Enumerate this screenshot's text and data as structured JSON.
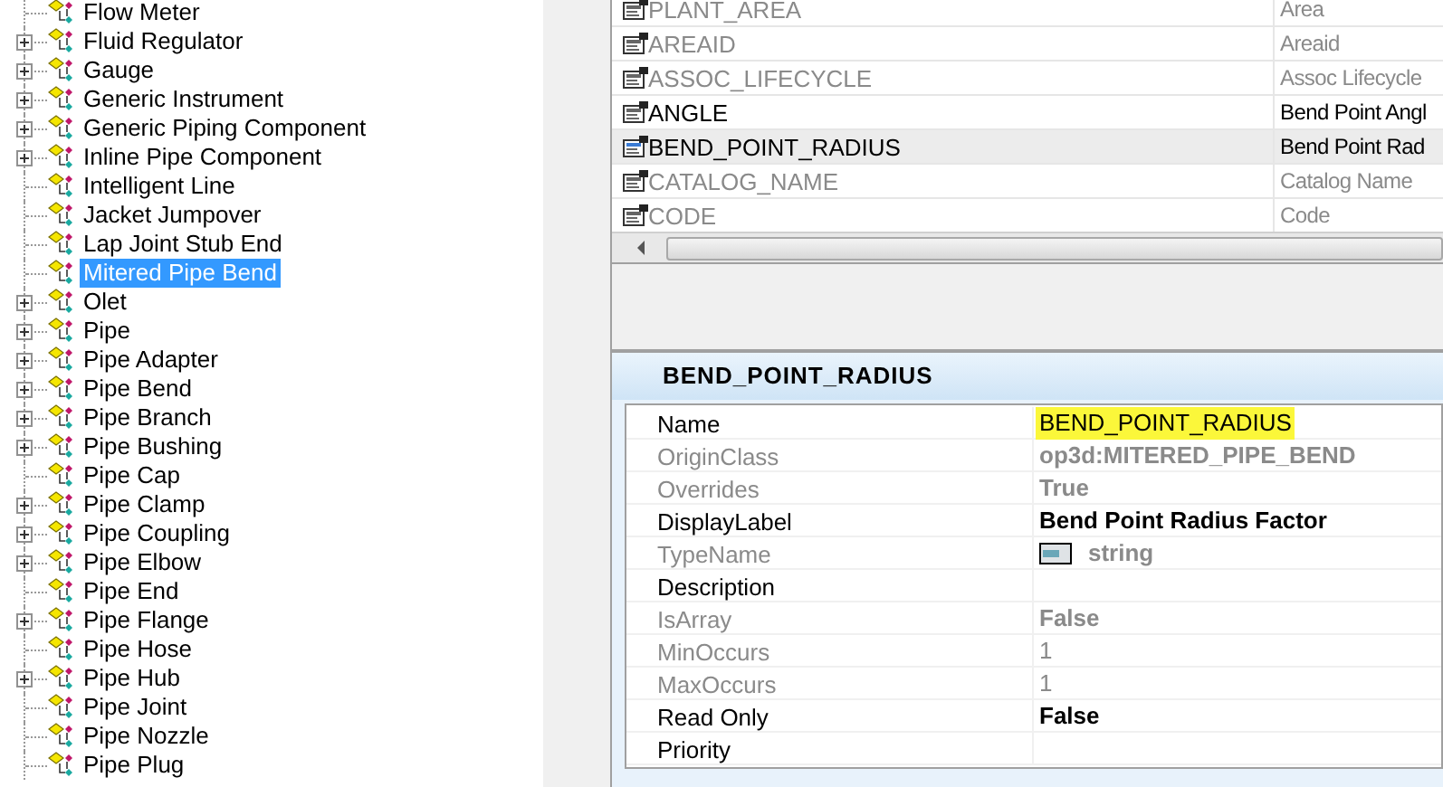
{
  "tree": {
    "items": [
      {
        "label": "Flow Meter",
        "expandable": false,
        "selected": false
      },
      {
        "label": "Fluid Regulator",
        "expandable": true,
        "selected": false
      },
      {
        "label": "Gauge",
        "expandable": true,
        "selected": false
      },
      {
        "label": "Generic Instrument",
        "expandable": true,
        "selected": false
      },
      {
        "label": "Generic Piping Component",
        "expandable": true,
        "selected": false
      },
      {
        "label": "Inline Pipe Component",
        "expandable": true,
        "selected": false
      },
      {
        "label": "Intelligent Line",
        "expandable": false,
        "selected": false
      },
      {
        "label": "Jacket Jumpover",
        "expandable": false,
        "selected": false
      },
      {
        "label": "Lap Joint Stub End",
        "expandable": false,
        "selected": false
      },
      {
        "label": "Mitered Pipe Bend",
        "expandable": false,
        "selected": true
      },
      {
        "label": "Olet",
        "expandable": true,
        "selected": false
      },
      {
        "label": "Pipe",
        "expandable": true,
        "selected": false
      },
      {
        "label": "Pipe Adapter",
        "expandable": true,
        "selected": false
      },
      {
        "label": "Pipe Bend",
        "expandable": true,
        "selected": false
      },
      {
        "label": "Pipe Branch",
        "expandable": true,
        "selected": false
      },
      {
        "label": "Pipe Bushing",
        "expandable": true,
        "selected": false
      },
      {
        "label": "Pipe Cap",
        "expandable": false,
        "selected": false
      },
      {
        "label": "Pipe Clamp",
        "expandable": true,
        "selected": false
      },
      {
        "label": "Pipe Coupling",
        "expandable": true,
        "selected": false
      },
      {
        "label": "Pipe Elbow",
        "expandable": true,
        "selected": false
      },
      {
        "label": "Pipe End",
        "expandable": false,
        "selected": false
      },
      {
        "label": "Pipe Flange",
        "expandable": true,
        "selected": false
      },
      {
        "label": "Pipe Hose",
        "expandable": false,
        "selected": false
      },
      {
        "label": "Pipe Hub",
        "expandable": true,
        "selected": false
      },
      {
        "label": "Pipe Joint",
        "expandable": false,
        "selected": false
      },
      {
        "label": "Pipe Nozzle",
        "expandable": false,
        "selected": false
      },
      {
        "label": "Pipe Plug",
        "expandable": false,
        "selected": false
      }
    ]
  },
  "property_list": {
    "rows": [
      {
        "name": "PLANT_AREA",
        "display_label": "Area",
        "enabled": false,
        "selected": false
      },
      {
        "name": "AREAID",
        "display_label": "Areaid",
        "enabled": false,
        "selected": false
      },
      {
        "name": "ASSOC_LIFECYCLE",
        "display_label": "Assoc Lifecycle",
        "enabled": false,
        "selected": false
      },
      {
        "name": "ANGLE",
        "display_label": "Bend Point Angl",
        "enabled": true,
        "selected": false
      },
      {
        "name": "BEND_POINT_RADIUS",
        "display_label": "Bend Point Rad",
        "enabled": true,
        "selected": true
      },
      {
        "name": "CATALOG_NAME",
        "display_label": "Catalog Name",
        "enabled": false,
        "selected": false
      },
      {
        "name": "CODE",
        "display_label": "Code",
        "enabled": false,
        "selected": false
      }
    ]
  },
  "details": {
    "title": "BEND_POINT_RADIUS",
    "rows": [
      {
        "label": "Name",
        "value": "BEND_POINT_RADIUS",
        "kind": "text",
        "enabled": true,
        "bold": false,
        "highlighted": true
      },
      {
        "label": "OriginClass",
        "value": "op3d:MITERED_PIPE_BEND",
        "kind": "text",
        "enabled": false,
        "bold": true,
        "highlighted": false
      },
      {
        "label": "Overrides",
        "value": "True",
        "kind": "text",
        "enabled": false,
        "bold": true,
        "highlighted": false
      },
      {
        "label": "DisplayLabel",
        "value": "Bend Point Radius Factor",
        "kind": "text",
        "enabled": true,
        "bold": true,
        "highlighted": false
      },
      {
        "label": "TypeName",
        "value": "string",
        "kind": "type",
        "enabled": false,
        "bold": true,
        "highlighted": false
      },
      {
        "label": "Description",
        "enabled": true
      },
      {
        "label": "IsArray",
        "value": "False",
        "kind": "text",
        "enabled": false,
        "bold": true,
        "highlighted": false
      },
      {
        "label": "MinOccurs",
        "value": "1",
        "kind": "text",
        "enabled": false,
        "bold": false,
        "highlighted": false
      },
      {
        "label": "MaxOccurs",
        "value": "1",
        "kind": "text",
        "enabled": false,
        "bold": false,
        "highlighted": false
      },
      {
        "label": "Read Only",
        "value": "False",
        "kind": "text",
        "enabled": true,
        "bold": true,
        "highlighted": false
      },
      {
        "label": "Priority",
        "enabled": true
      }
    ]
  }
}
